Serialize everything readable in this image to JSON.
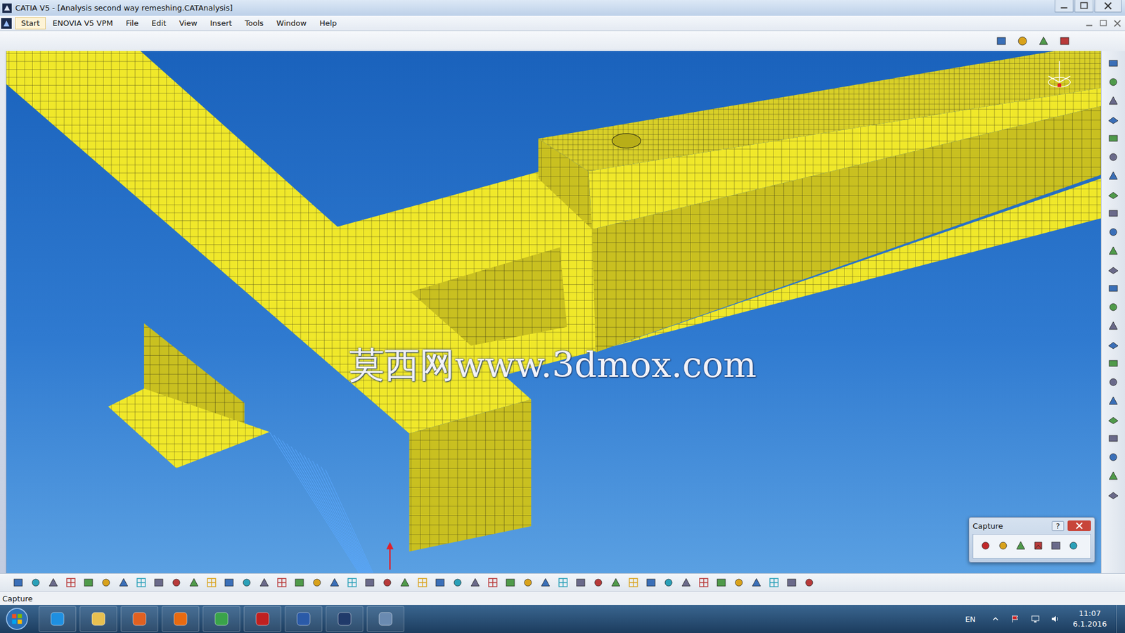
{
  "window": {
    "title": "CATIA V5 - [Analysis second way remeshing.CATAnalysis]"
  },
  "menu": [
    {
      "label": "Start",
      "selected": true
    },
    {
      "label": "ENOVIA V5 VPM",
      "selected": false
    },
    {
      "label": "File",
      "selected": false
    },
    {
      "label": "Edit",
      "selected": false
    },
    {
      "label": "View",
      "selected": false
    },
    {
      "label": "Insert",
      "selected": false
    },
    {
      "label": "Tools",
      "selected": false
    },
    {
      "label": "Window",
      "selected": false
    },
    {
      "label": "Help",
      "selected": false
    }
  ],
  "viewport": {
    "watermark": "莫西网www.3dmox.com"
  },
  "capture_toolbar": {
    "title": "Capture",
    "help": "?"
  },
  "status_bar": {
    "text": "Capture"
  },
  "taskbar": {
    "language": "EN",
    "time": "11:07",
    "date": "6.1.2016"
  }
}
